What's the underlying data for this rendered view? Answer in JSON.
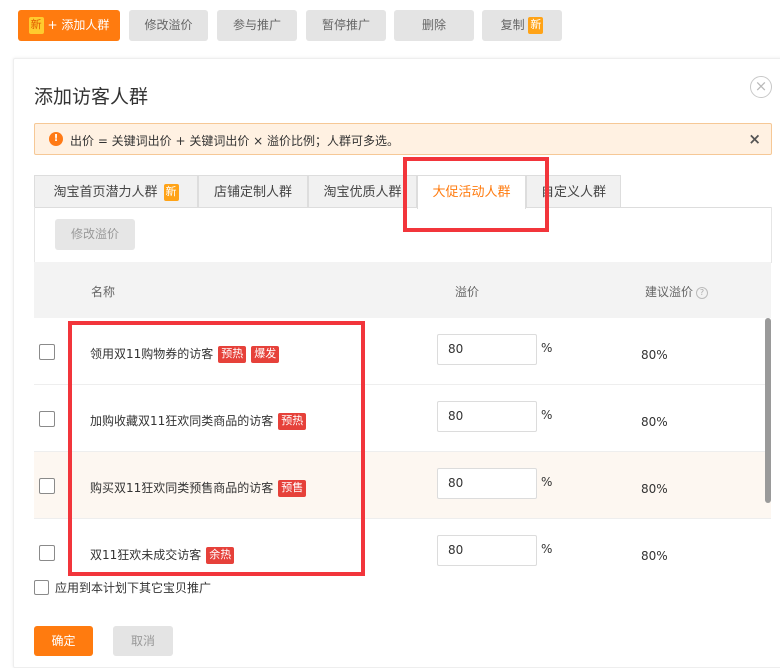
{
  "toolbar": {
    "add_badge": "新",
    "add_label": "+ 添加人群",
    "edit_bid": "修改溢价",
    "join_promo": "参与推广",
    "pause_promo": "暂停推广",
    "delete": "删除",
    "copy": "复制",
    "copy_badge": "新"
  },
  "dialog": {
    "title": "添加访客人群",
    "close_glyph": "×",
    "alert": {
      "icon": "!",
      "text": "出价 = 关键词出价 + 关键词出价 × 溢价比例；人群可多选。",
      "close_glyph": "×"
    },
    "tabs": [
      {
        "label": "淘宝首页潜力人群",
        "badge": "新"
      },
      {
        "label": "店铺定制人群"
      },
      {
        "label": "淘宝优质人群"
      },
      {
        "label": "大促活动人群",
        "active": true
      },
      {
        "label": "自定义人群"
      }
    ],
    "edit_bid_button": "修改溢价",
    "table": {
      "headers": {
        "name": "名称",
        "premium": "溢价",
        "suggested": "建议溢价"
      },
      "rows": [
        {
          "name": "领用双11购物券的访客",
          "tags": [
            "预热",
            "爆发"
          ],
          "value": "80",
          "unit": "%",
          "suggested": "80%"
        },
        {
          "name": "加购收藏双11狂欢同类商品的访客",
          "tags": [
            "预热"
          ],
          "value": "80",
          "unit": "%",
          "suggested": "80%"
        },
        {
          "name": "购买双11狂欢同类预售商品的访客",
          "tags": [
            "预售"
          ],
          "value": "80",
          "unit": "%",
          "suggested": "80%"
        },
        {
          "name": "双11狂欢未成交访客",
          "tags": [
            "余热"
          ],
          "value": "80",
          "unit": "%",
          "suggested": "80%"
        }
      ]
    },
    "apply_label": "应用到本计划下其它宝贝推广",
    "ok_button": "确定",
    "cancel_button": "取消"
  },
  "colors": {
    "accent": "#ff7b0f",
    "tag_red": "#e6413a",
    "annotation_red": "#f2353b",
    "alert_bg": "#fff1e2"
  }
}
